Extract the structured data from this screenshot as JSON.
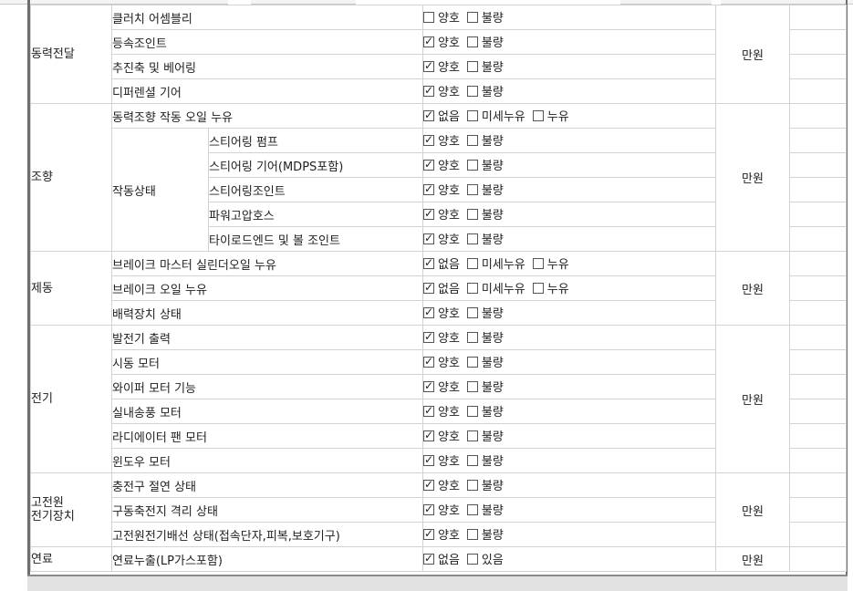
{
  "price_unit": "만원",
  "sections": [
    {
      "category": "동력전달",
      "rows": [
        {
          "item": "클러치 어셈블리",
          "options": [
            {
              "label": "양호",
              "checked": false
            },
            {
              "label": "불량",
              "checked": false
            }
          ]
        },
        {
          "item": "등속조인트",
          "options": [
            {
              "label": "양호",
              "checked": true
            },
            {
              "label": "불량",
              "checked": false
            }
          ]
        },
        {
          "item": "추진축 및 베어링",
          "options": [
            {
              "label": "양호",
              "checked": true
            },
            {
              "label": "불량",
              "checked": false
            }
          ]
        },
        {
          "item": "디퍼렌셜 기어",
          "options": [
            {
              "label": "양호",
              "checked": true
            },
            {
              "label": "불량",
              "checked": false
            }
          ]
        }
      ]
    },
    {
      "category": "조향",
      "rows": [
        {
          "item": "동력조향 작동 오일 누유",
          "options": [
            {
              "label": "없음",
              "checked": true
            },
            {
              "label": "미세누유",
              "checked": false
            },
            {
              "label": "누유",
              "checked": false
            }
          ]
        }
      ],
      "group": {
        "label": "작동상태",
        "rows": [
          {
            "item": "스티어링 펌프",
            "options": [
              {
                "label": "양호",
                "checked": true
              },
              {
                "label": "불량",
                "checked": false
              }
            ]
          },
          {
            "item": "스티어링 기어(MDPS포함)",
            "options": [
              {
                "label": "양호",
                "checked": true
              },
              {
                "label": "불량",
                "checked": false
              }
            ]
          },
          {
            "item": "스티어링조인트",
            "options": [
              {
                "label": "양호",
                "checked": true
              },
              {
                "label": "불량",
                "checked": false
              }
            ]
          },
          {
            "item": "파워고압호스",
            "options": [
              {
                "label": "양호",
                "checked": true
              },
              {
                "label": "불량",
                "checked": false
              }
            ]
          },
          {
            "item": "타이로드엔드 및 볼 조인트",
            "options": [
              {
                "label": "양호",
                "checked": true
              },
              {
                "label": "불량",
                "checked": false
              }
            ]
          }
        ]
      }
    },
    {
      "category": "제동",
      "rows": [
        {
          "item": "브레이크 마스터 실린더오일 누유",
          "options": [
            {
              "label": "없음",
              "checked": true
            },
            {
              "label": "미세누유",
              "checked": false
            },
            {
              "label": "누유",
              "checked": false
            }
          ]
        },
        {
          "item": "브레이크 오일 누유",
          "options": [
            {
              "label": "없음",
              "checked": true
            },
            {
              "label": "미세누유",
              "checked": false
            },
            {
              "label": "누유",
              "checked": false
            }
          ]
        },
        {
          "item": "배력장치 상태",
          "options": [
            {
              "label": "양호",
              "checked": true
            },
            {
              "label": "불량",
              "checked": false
            }
          ]
        }
      ]
    },
    {
      "category": "전기",
      "rows": [
        {
          "item": "발전기 출력",
          "options": [
            {
              "label": "양호",
              "checked": true
            },
            {
              "label": "불량",
              "checked": false
            }
          ]
        },
        {
          "item": "시동 모터",
          "options": [
            {
              "label": "양호",
              "checked": true
            },
            {
              "label": "불량",
              "checked": false
            }
          ]
        },
        {
          "item": "와이퍼 모터 기능",
          "options": [
            {
              "label": "양호",
              "checked": true
            },
            {
              "label": "불량",
              "checked": false
            }
          ]
        },
        {
          "item": "실내송풍 모터",
          "options": [
            {
              "label": "양호",
              "checked": true
            },
            {
              "label": "불량",
              "checked": false
            }
          ]
        },
        {
          "item": "라디에이터 팬 모터",
          "options": [
            {
              "label": "양호",
              "checked": true
            },
            {
              "label": "불량",
              "checked": false
            }
          ]
        },
        {
          "item": "윈도우 모터",
          "options": [
            {
              "label": "양호",
              "checked": true
            },
            {
              "label": "불량",
              "checked": false
            }
          ]
        }
      ]
    },
    {
      "category": "고전원\n전기장치",
      "rows": [
        {
          "item": "충전구 절연 상태",
          "options": [
            {
              "label": "양호",
              "checked": true
            },
            {
              "label": "불량",
              "checked": false
            }
          ]
        },
        {
          "item": "구동축전지 격리 상태",
          "options": [
            {
              "label": "양호",
              "checked": true
            },
            {
              "label": "불량",
              "checked": false
            }
          ]
        },
        {
          "item": "고전원전기배선 상태(접속단자,피복,보호기구)",
          "options": [
            {
              "label": "양호",
              "checked": true
            },
            {
              "label": "불량",
              "checked": false
            }
          ]
        }
      ]
    },
    {
      "category": "연료",
      "rows": [
        {
          "item": "연료누출(LP가스포함)",
          "options": [
            {
              "label": "없음",
              "checked": true
            },
            {
              "label": "있음",
              "checked": false
            }
          ]
        }
      ]
    }
  ]
}
